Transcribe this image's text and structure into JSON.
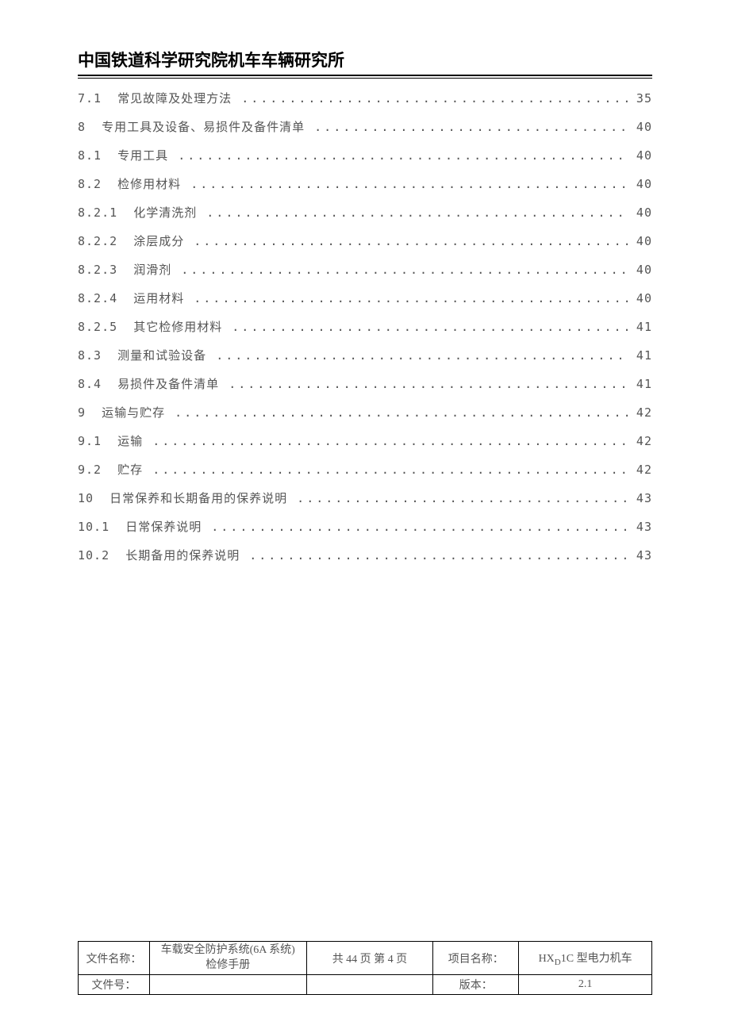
{
  "header": {
    "title": "中国铁道科学研究院机车车辆研究所"
  },
  "toc": [
    {
      "num": "7.1",
      "title": "常见故障及处理方法",
      "page": "35"
    },
    {
      "num": "8",
      "title": "专用工具及设备、易损件及备件清单",
      "page": "40"
    },
    {
      "num": "8.1",
      "title": "专用工具",
      "page": "40"
    },
    {
      "num": "8.2",
      "title": "检修用材料",
      "page": "40"
    },
    {
      "num": "8.2.1",
      "title": "化学清洗剂",
      "page": "40"
    },
    {
      "num": "8.2.2",
      "title": "涂层成分",
      "page": "40"
    },
    {
      "num": "8.2.3",
      "title": "润滑剂",
      "page": "40"
    },
    {
      "num": "8.2.4",
      "title": "运用材料",
      "page": "40"
    },
    {
      "num": "8.2.5",
      "title": "其它检修用材料",
      "page": "41"
    },
    {
      "num": "8.3",
      "title": "测量和试验设备",
      "page": "41"
    },
    {
      "num": "8.4",
      "title": "易损件及备件清单",
      "page": "41"
    },
    {
      "num": "9",
      "title": "运输与贮存",
      "page": "42"
    },
    {
      "num": "9.1",
      "title": "运输",
      "page": "42"
    },
    {
      "num": "9.2",
      "title": "贮存",
      "page": "42"
    },
    {
      "num": "10",
      "title": "日常保养和长期备用的保养说明",
      "page": "43"
    },
    {
      "num": "10.1",
      "title": "日常保养说明",
      "page": "43"
    },
    {
      "num": "10.2",
      "title": "长期备用的保养说明",
      "page": "43"
    }
  ],
  "footer": {
    "file_name_label": "文件名称：",
    "file_name_value_line1": "车载安全防护系统(6A 系统)",
    "file_name_value_line2": "检修手册",
    "pagination": "共 44 页    第 4 页",
    "project_label": "项目名称：",
    "project_value_prefix": "HX",
    "project_value_sub": "D",
    "project_value_suffix": "1C 型电力机车",
    "file_no_label": "文件号：",
    "file_no_value": "",
    "version_label": "版本：",
    "version_value": "2.1"
  }
}
